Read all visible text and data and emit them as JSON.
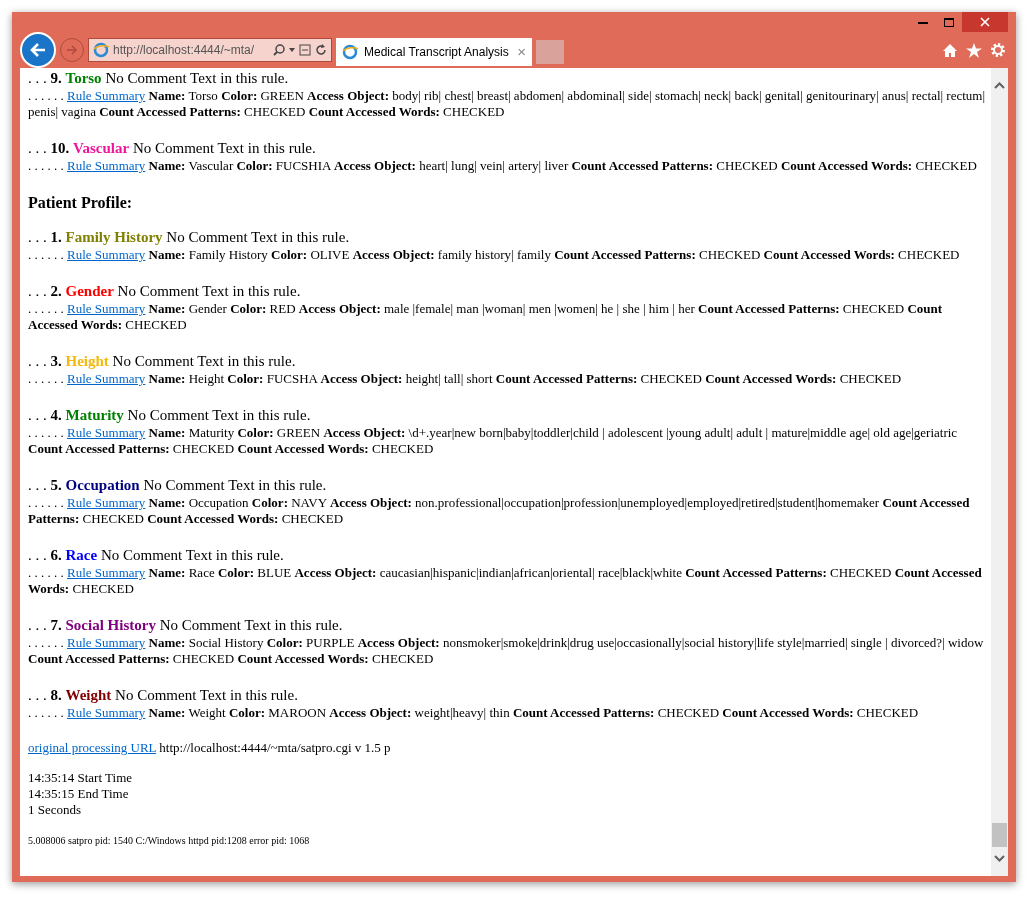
{
  "browser": {
    "address": "http://localhost:4444/~mta/",
    "tab_title": "Medical Transcript Analysis",
    "tab_close": "×"
  },
  "content": [
    {
      "kind": "rule",
      "prefix": ". . .",
      "number": "9.",
      "title": "Torso",
      "color": "#008000",
      "comment": "No Comment Text in this rule.",
      "dots": ". . . . . .",
      "link": "Rule Summary",
      "details": "**Name:** Torso **Color:** GREEN **Access Object:** body| rib| chest| breast| abdomen| abdominal| side| stomach| neck| back| genital| genitourinary| anus| rectal| rectum| penis| vagina **Count Accessed Patterns:** CHECKED **Count Accessed Words:** CHECKED"
    },
    {
      "kind": "rule",
      "prefix": ". . .",
      "number": "10.",
      "title": "Vascular",
      "color": "#f0149a",
      "comment": "No Comment Text in this rule.",
      "dots": ". . . . . .",
      "link": "Rule Summary",
      "details": "**Name:** Vascular **Color:** FUCSHIA **Access Object:** heart| lung| vein| artery| liver **Count Accessed Patterns:** CHECKED **Count Accessed Words:** CHECKED"
    },
    {
      "kind": "heading",
      "text": "Patient Profile:"
    },
    {
      "kind": "rule",
      "prefix": ". . .",
      "number": "1.",
      "title": "Family History",
      "color": "#808000",
      "comment": "No Comment Text in this rule.",
      "dots": ". . . . . .",
      "link": "Rule Summary",
      "details": "**Name:** Family History **Color:** OLIVE **Access Object:** family history| family **Count Accessed Patterns:** CHECKED **Count Accessed Words:** CHECKED"
    },
    {
      "kind": "rule",
      "prefix": ". . .",
      "number": "2.",
      "title": "Gender",
      "color": "#ff0000",
      "comment": "No Comment Text in this rule.",
      "dots": ". . . . . .",
      "link": "Rule Summary",
      "details": "**Name:** Gender **Color:** RED **Access Object:** male |female| man |woman| men |women| he | she | him | her **Count Accessed Patterns:** CHECKED **Count Accessed Words:** CHECKED"
    },
    {
      "kind": "rule",
      "prefix": ". . .",
      "number": "3.",
      "title": "Height",
      "color": "#f2b90f",
      "comment": "No Comment Text in this rule.",
      "dots": ". . . . . .",
      "link": "Rule Summary",
      "details": "**Name:** Height **Color:** FUCSHA **Access Object:** height| tall| short **Count Accessed Patterns:** CHECKED **Count Accessed Words:** CHECKED"
    },
    {
      "kind": "rule",
      "prefix": ". . .",
      "number": "4.",
      "title": "Maturity",
      "color": "#008000",
      "comment": "No Comment Text in this rule.",
      "dots": ". . . . . .",
      "link": "Rule Summary",
      "details": "**Name:** Maturity **Color:** GREEN **Access Object:** \\d+.year|new born|baby|toddler|child | adolescent |young adult| adult | mature|middle age| old age|geriatric **Count Accessed Patterns:** CHECKED **Count Accessed Words:** CHECKED"
    },
    {
      "kind": "rule",
      "prefix": ". . .",
      "number": "5.",
      "title": "Occupation",
      "color": "#000080",
      "comment": "No Comment Text in this rule.",
      "dots": ". . . . . .",
      "link": "Rule Summary",
      "details": "**Name:** Occupation **Color:** NAVY **Access Object:** non.professional|occupation|profession|unemployed|employed|retired|student|homemaker **Count Accessed Patterns:** CHECKED **Count Accessed Words:** CHECKED"
    },
    {
      "kind": "rule",
      "prefix": ". . .",
      "number": "6.",
      "title": "Race",
      "color": "#0000ff",
      "comment": "No Comment Text in this rule.",
      "dots": ". . . . . .",
      "link": "Rule Summary",
      "details": "**Name:** Race **Color:** BLUE **Access Object:** caucasian|hispanic|indian|african|oriental| race|black|white **Count Accessed Patterns:** CHECKED **Count Accessed Words:** CHECKED"
    },
    {
      "kind": "rule",
      "prefix": ". . .",
      "number": "7.",
      "title": "Social History",
      "color": "#800080",
      "comment": "No Comment Text in this rule.",
      "dots": ". . . . . .",
      "link": "Rule Summary",
      "details": "**Name:** Social History **Color:** PURPLE **Access Object:** nonsmoker|smoke|drink|drug use|occasionally|social history|life style|married| single | divorced?| widow **Count Accessed Patterns:** CHECKED **Count Accessed Words:** CHECKED"
    },
    {
      "kind": "rule",
      "prefix": ". . .",
      "number": "8.",
      "title": "Weight",
      "color": "#800000",
      "comment": "No Comment Text in this rule.",
      "dots": ". . . . . .",
      "link": "Rule Summary",
      "details": "**Name:** Weight **Color:** MAROON **Access Object:** weight|heavy| thin **Count Accessed Patterns:** CHECKED **Count Accessed Words:** CHECKED"
    }
  ],
  "footer": {
    "link": "original processing URL",
    "url_text": "http://localhost:4444/~mta/satpro.cgi v 1.5 p",
    "times": [
      "14:35:14 Start Time",
      "14:35:15 End Time",
      "1 Seconds"
    ],
    "pid_line": "5.008006 satpro pid: 1540 C:/Windows httpd pid:1208 error pid: 1068"
  }
}
